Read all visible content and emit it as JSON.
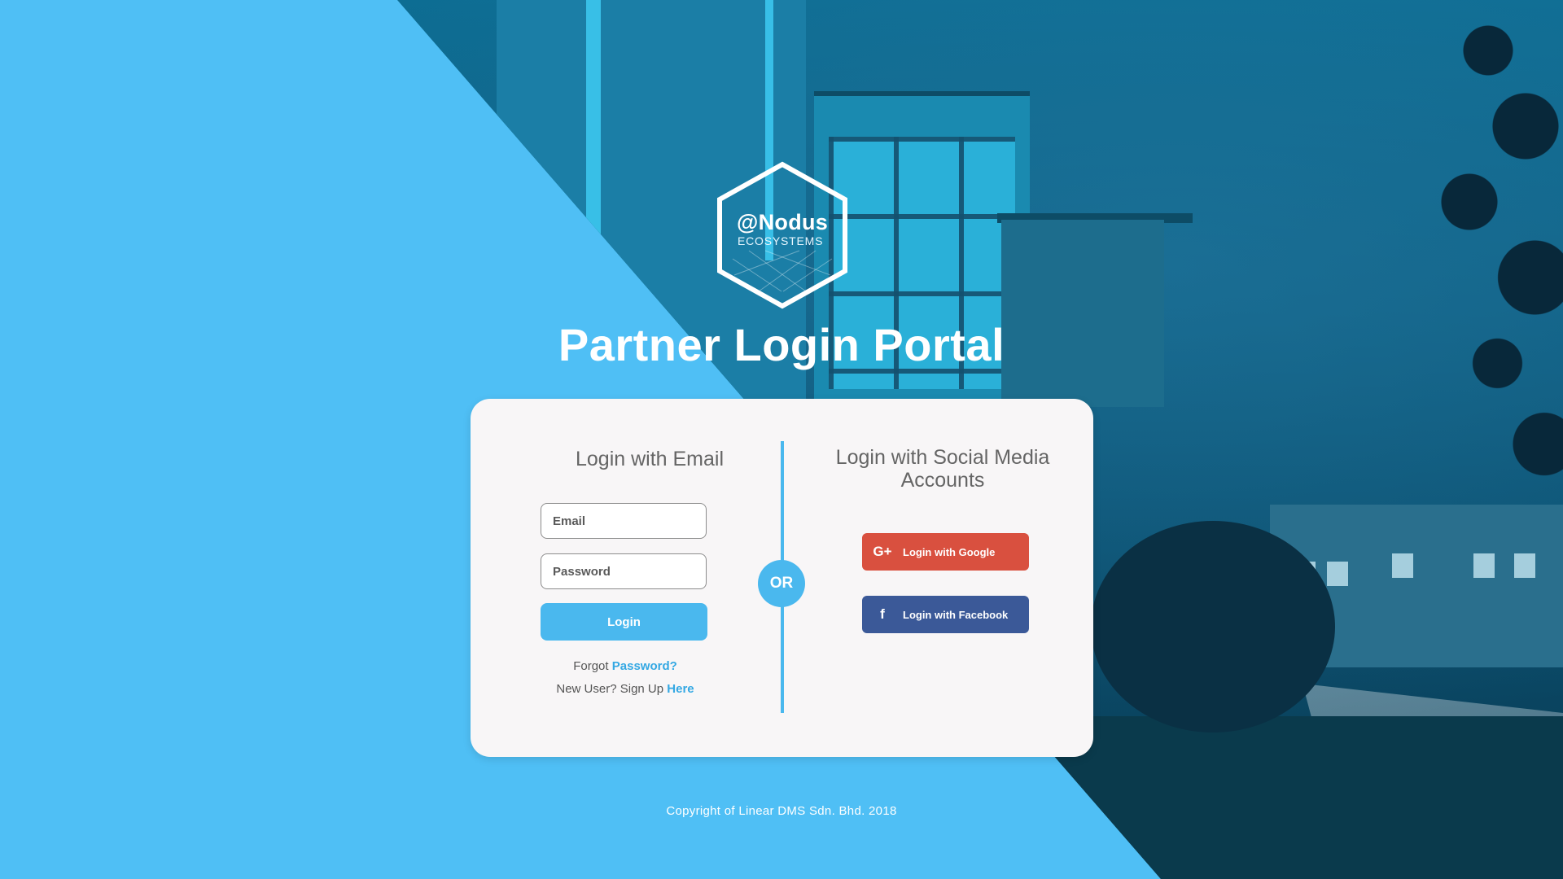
{
  "logo": {
    "name": "@Nodus",
    "sub": "ECOSYSTEMS"
  },
  "header": {
    "title": "Partner Login Portal"
  },
  "email_login": {
    "title": "Login with Email",
    "email_placeholder": "Email",
    "password_placeholder": "Password",
    "login_label": "Login",
    "forgot_prefix": "Forgot",
    "forgot_link": "Password?",
    "signup_prefix": "New User? Sign Up",
    "signup_link": "Here"
  },
  "divider": {
    "or_label": "OR"
  },
  "social_login": {
    "title": "Login with Social Media Accounts",
    "google_label": "Login with Google",
    "google_icon": "G+",
    "facebook_label": "Login with Facebook",
    "facebook_icon": "f"
  },
  "footer": {
    "copyright": "Copyright of Linear DMS Sdn. Bhd. 2018"
  },
  "colors": {
    "accent": "#4ab8ee",
    "background": "#4fbff5",
    "google": "#d9503f",
    "facebook": "#3b5998"
  }
}
